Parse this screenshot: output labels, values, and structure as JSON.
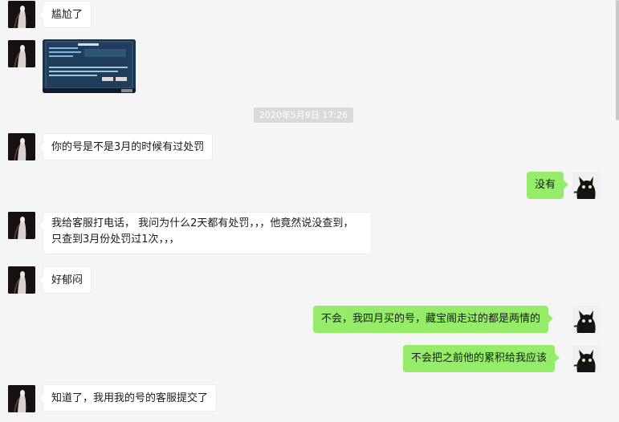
{
  "chat": {
    "timestamp": "2020年5月9日 17:26",
    "messages": [
      {
        "side": "in",
        "text": "尴尬了"
      },
      {
        "side": "in",
        "type": "image"
      },
      {
        "side": "in",
        "text": "你的号是不是3月的时候有过处罚"
      },
      {
        "side": "out",
        "text": "没有"
      },
      {
        "side": "in",
        "text": "我给客服打电话， 我问为什么2天都有处罚，，，他竟然说没查到，只查到3月份处罚过1次，，，"
      },
      {
        "side": "in",
        "text": "好郁闷"
      },
      {
        "side": "out",
        "text": "不会，我四月买的号，藏宝阁走过的都是两情的"
      },
      {
        "side": "out",
        "text": "不会把之前他的累积给我应该"
      },
      {
        "side": "in",
        "text": "知道了，我用我的号的客服提交了"
      }
    ]
  },
  "colors": {
    "background": "#f5f5f5",
    "incoming_bubble": "#ffffff",
    "outgoing_bubble": "#95ec69",
    "timestamp_bg": "#dadada"
  }
}
